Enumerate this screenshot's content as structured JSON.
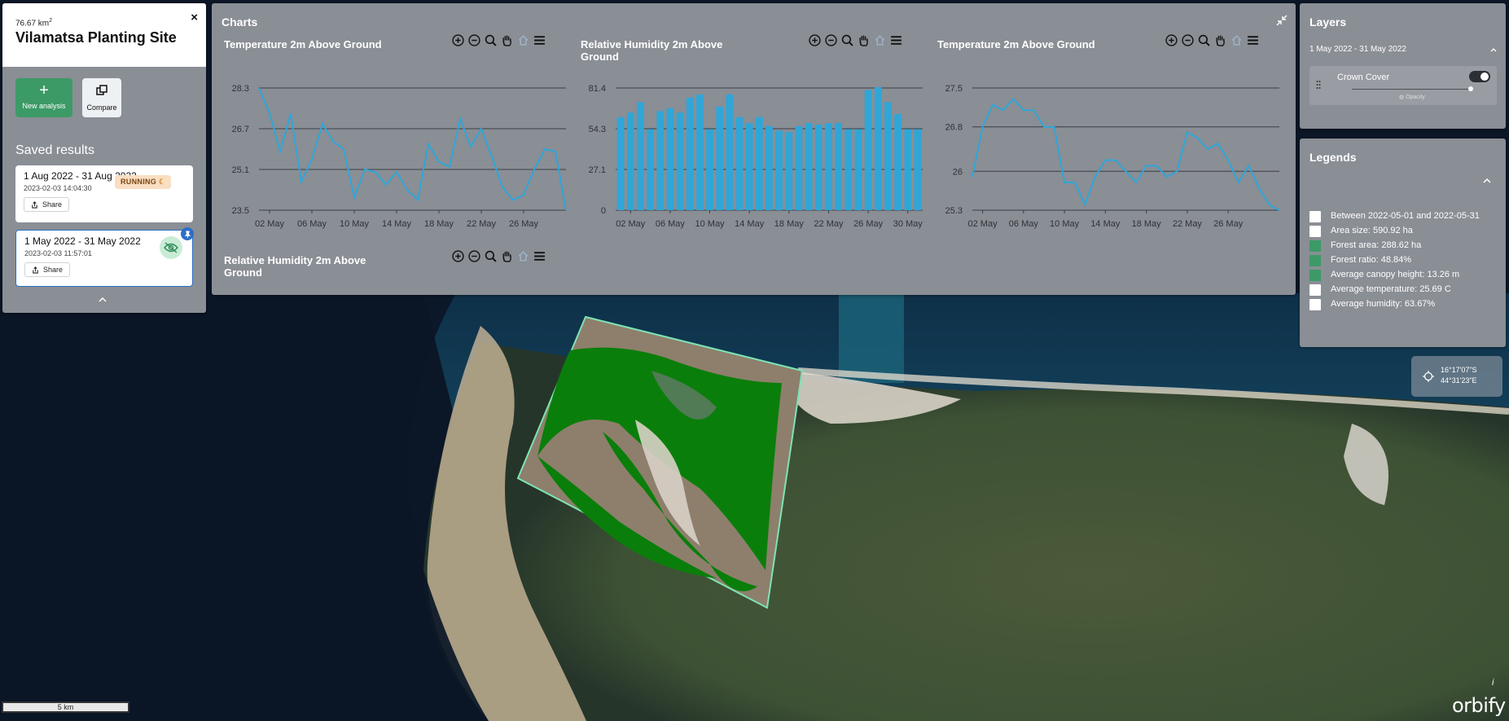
{
  "site": {
    "area": "76.67 km",
    "area_sup": "2",
    "title": "Vilamatsa Planting Site",
    "close": "×"
  },
  "actions": {
    "new_analysis": "New analysis",
    "compare": "Compare"
  },
  "saved": {
    "heading": "Saved results",
    "results": [
      {
        "date": "1 Aug 2022 - 31 Aug 2022",
        "created": "2023-02-03 14:04:30",
        "status": "RUNNING",
        "share": "Share"
      },
      {
        "date": "1 May 2022 - 31 May 2022",
        "created": "2023-02-03 11:57:01",
        "share": "Share"
      }
    ]
  },
  "charts": {
    "title": "Charts",
    "items": [
      {
        "title_lines": [
          "Temperature 2m Above Ground"
        ]
      },
      {
        "title_lines": [
          "Relative Humidity 2m Above",
          "Ground"
        ]
      },
      {
        "title_lines": [
          "Temperature 2m Above Ground"
        ]
      },
      {
        "title_lines": [
          "Relative Humidity 2m Above",
          "Ground"
        ]
      }
    ]
  },
  "layers": {
    "title": "Layers",
    "period": "1 May 2022 - 31 May 2022",
    "layer_name": "Crown Cover",
    "opacity_label": "Opacity"
  },
  "legends": {
    "title": "Legends",
    "items": [
      {
        "text": "Between 2022-05-01 and 2022-05-31",
        "color": "#ffffff"
      },
      {
        "text": "Area size: 590.92 ha",
        "color": "#ffffff"
      },
      {
        "text": "Forest area: 288.62 ha",
        "color": "#3c9a67"
      },
      {
        "text": "Forest ratio: 48.84%",
        "color": "#3c9a67"
      },
      {
        "text": "Average canopy height: 13.26 m",
        "color": "#3c9a67"
      },
      {
        "text": "Average temperature: 25.69 C",
        "color": "#ffffff"
      },
      {
        "text": "Average humidity: 63.67%",
        "color": "#ffffff"
      }
    ]
  },
  "coords": {
    "lat": "16°17'07\"S",
    "lon": "44°31'23\"E"
  },
  "scale": {
    "label": "5 km"
  },
  "brand": {
    "name": "orbify",
    "info": "i"
  },
  "colors": {
    "accent_green": "#3c9a67",
    "chart_blue": "#2fa6d8",
    "panel_gray": "#8a8e95",
    "forest_green": "#0a7e0a"
  },
  "chart_data": [
    {
      "type": "line",
      "title": "Temperature 2m Above Ground",
      "x": [
        "01 May",
        "02 May",
        "03 May",
        "04 May",
        "05 May",
        "06 May",
        "07 May",
        "08 May",
        "09 May",
        "10 May",
        "11 May",
        "12 May",
        "13 May",
        "14 May",
        "15 May",
        "16 May",
        "17 May",
        "18 May",
        "19 May",
        "20 May",
        "21 May",
        "22 May",
        "23 May",
        "24 May",
        "25 May",
        "26 May",
        "27 May",
        "28 May",
        "29 May",
        "30 May",
        "31 May"
      ],
      "x_ticks": [
        "02 May",
        "06 May",
        "10 May",
        "14 May",
        "18 May",
        "22 May",
        "26 May"
      ],
      "values": [
        28.3,
        27.3,
        25.8,
        27.3,
        24.6,
        25.5,
        26.9,
        26.2,
        25.9,
        24.0,
        25.1,
        25.0,
        24.5,
        25.0,
        24.3,
        23.9,
        26.1,
        25.4,
        25.2,
        27.1,
        26.0,
        26.7,
        25.6,
        24.4,
        23.9,
        24.1,
        25.1,
        25.9,
        25.8,
        23.5
      ],
      "y_ticks": [
        23.5,
        25.1,
        26.7,
        28.3
      ],
      "ylim": [
        23.5,
        28.3
      ]
    },
    {
      "type": "bar",
      "title": "Relative Humidity 2m Above Ground",
      "categories": [
        "01 May",
        "02 May",
        "03 May",
        "04 May",
        "05 May",
        "06 May",
        "07 May",
        "08 May",
        "09 May",
        "10 May",
        "11 May",
        "12 May",
        "13 May",
        "14 May",
        "15 May",
        "16 May",
        "17 May",
        "18 May",
        "19 May",
        "20 May",
        "21 May",
        "22 May",
        "23 May",
        "24 May",
        "25 May",
        "26 May",
        "27 May",
        "28 May",
        "29 May",
        "30 May",
        "31 May"
      ],
      "x_ticks": [
        "02 May",
        "06 May",
        "10 May",
        "14 May",
        "18 May",
        "22 May",
        "26 May",
        "30 May"
      ],
      "values": [
        62,
        65,
        72,
        54,
        66,
        68,
        65,
        75,
        77,
        54,
        69,
        77,
        62,
        58,
        62,
        56,
        53,
        52,
        56,
        58,
        57,
        58,
        58,
        54,
        54,
        80,
        82,
        72,
        64,
        54,
        54
      ],
      "y_ticks": [
        0,
        27.1,
        54.3,
        81.4
      ],
      "ylim": [
        0,
        81.4
      ]
    },
    {
      "type": "line",
      "title": "Temperature 2m Above Ground",
      "x": [
        "01 May",
        "02 May",
        "03 May",
        "04 May",
        "05 May",
        "06 May",
        "07 May",
        "08 May",
        "09 May",
        "10 May",
        "11 May",
        "12 May",
        "13 May",
        "14 May",
        "15 May",
        "16 May",
        "17 May",
        "18 May",
        "19 May",
        "20 May",
        "21 May",
        "22 May",
        "23 May",
        "24 May",
        "25 May",
        "26 May",
        "27 May",
        "28 May",
        "29 May",
        "30 May",
        "31 May"
      ],
      "x_ticks": [
        "02 May",
        "06 May",
        "10 May",
        "14 May",
        "18 May",
        "22 May",
        "26 May"
      ],
      "values": [
        25.9,
        26.8,
        27.2,
        27.1,
        27.3,
        27.1,
        27.1,
        26.8,
        26.8,
        25.8,
        25.8,
        25.4,
        25.9,
        26.2,
        26.2,
        26.0,
        25.8,
        26.1,
        26.1,
        25.9,
        26.0,
        26.7,
        26.6,
        26.4,
        26.5,
        26.2,
        25.8,
        26.1,
        25.7,
        25.4,
        25.3
      ],
      "y_ticks": [
        25.3,
        26,
        26.8,
        27.5
      ],
      "ylim": [
        25.3,
        27.5
      ]
    }
  ]
}
